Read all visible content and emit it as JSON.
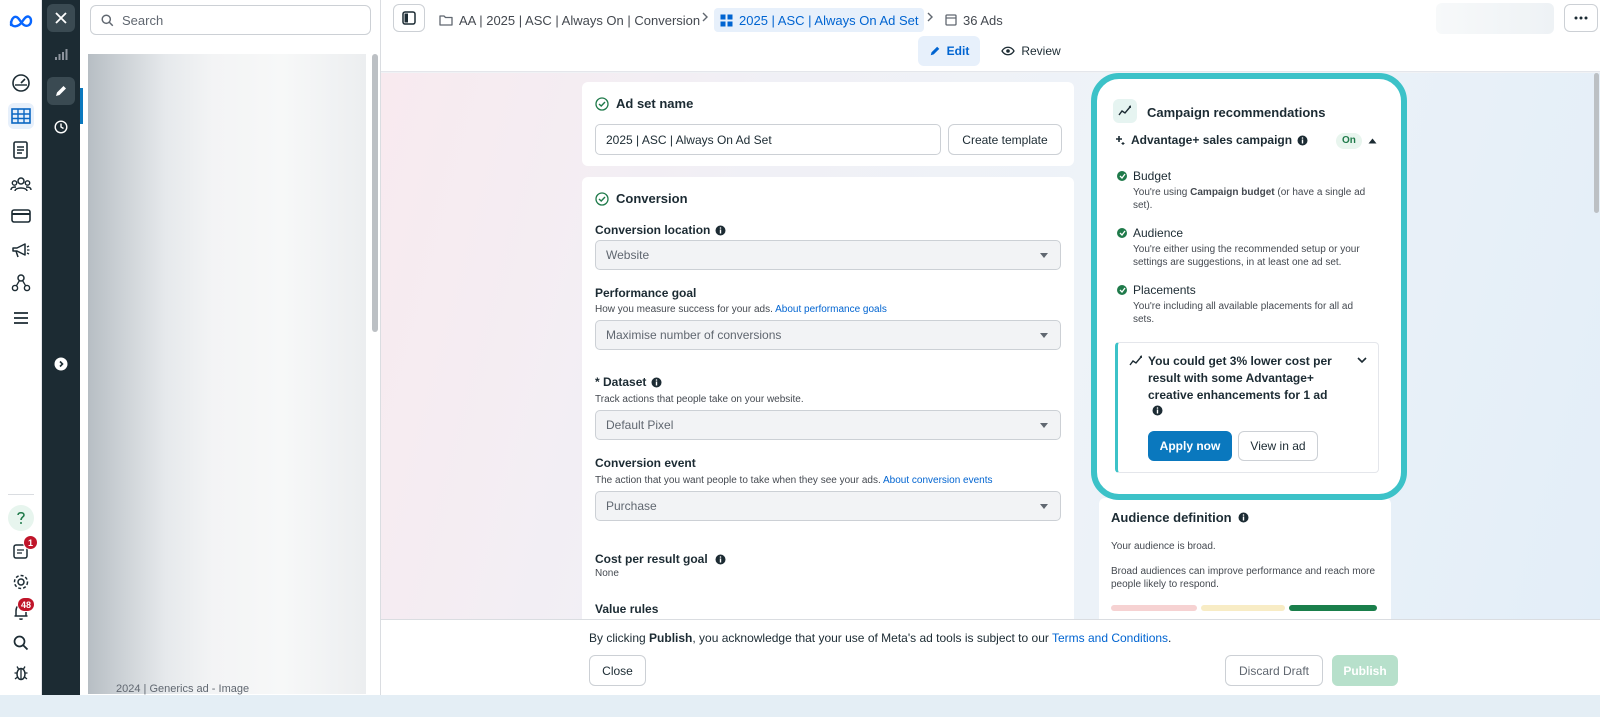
{
  "rail": {
    "badges": {
      "notices": "1",
      "notifications": "48"
    }
  },
  "nav": {
    "search_placeholder": "Search",
    "obscured_item": "2024 | Generics ad - Image"
  },
  "breadcrumb": {
    "campaign": "AA | 2025 | ASC | Always On | Conversion",
    "ad_set": "2025 | ASC | Always On Ad Set",
    "ads": "36 Ads"
  },
  "mode_tabs": {
    "edit": "Edit",
    "review": "Review"
  },
  "adset_name": {
    "title": "Ad set name",
    "value": "2025 | ASC | Always On Ad Set",
    "create_template": "Create template"
  },
  "conversion": {
    "title": "Conversion",
    "location_label": "Conversion location",
    "location_value": "Website",
    "performance_goal_label": "Performance goal",
    "performance_goal_desc": "How you measure success for your ads.",
    "performance_goal_link": "About performance goals",
    "performance_goal_value": "Maximise number of conversions",
    "dataset_label": "* Dataset",
    "dataset_desc": "Track actions that people take on your website.",
    "dataset_value": "Default Pixel",
    "event_label": "Conversion event",
    "event_desc": "The action that you want people to take when they see your ads.",
    "event_link": "About conversion events",
    "event_value": "Purchase",
    "cost_goal_label": "Cost per result goal",
    "cost_goal_value": "None",
    "cut_label": "Value rules"
  },
  "recommendations": {
    "title": "Campaign recommendations",
    "campaign_type": "Advantage+ sales campaign",
    "status": "On",
    "items": [
      {
        "title": "Budget",
        "desc_pre": "You're using ",
        "desc_bold": "Campaign budget",
        "desc_post": " (or have a single ad set)."
      },
      {
        "title": "Audience",
        "desc": "You're either using the recommended setup or your settings are suggestions, in at least one ad set."
      },
      {
        "title": "Placements",
        "desc": "You're including all available placements for all ad sets."
      }
    ],
    "suggestion": "You could get 3% lower cost per result with some Advantage+ creative enhancements for 1 ad",
    "apply_now": "Apply now",
    "view_in_ad": "View in ad"
  },
  "audience_definition": {
    "title": "Audience definition",
    "status": "Your audience is broad.",
    "desc": "Broad audiences can improve performance and reach more people likely to respond.",
    "meter_colors": [
      "#f6d2d2",
      "#f8ecc5",
      "#1a7f4b"
    ]
  },
  "bottom": {
    "notice_pre": "By clicking ",
    "notice_bold": "Publish",
    "notice_mid": ", you acknowledge that your use of Meta's ad tools is subject to our ",
    "notice_link": "Terms and Conditions",
    "notice_end": ".",
    "close": "Close",
    "discard": "Discard Draft",
    "publish": "Publish"
  },
  "colors": {
    "brand": "#0a78be",
    "highlight": "#3cc2c8",
    "success": "#1f7a4a",
    "dark_strip": "#1c2b33"
  }
}
